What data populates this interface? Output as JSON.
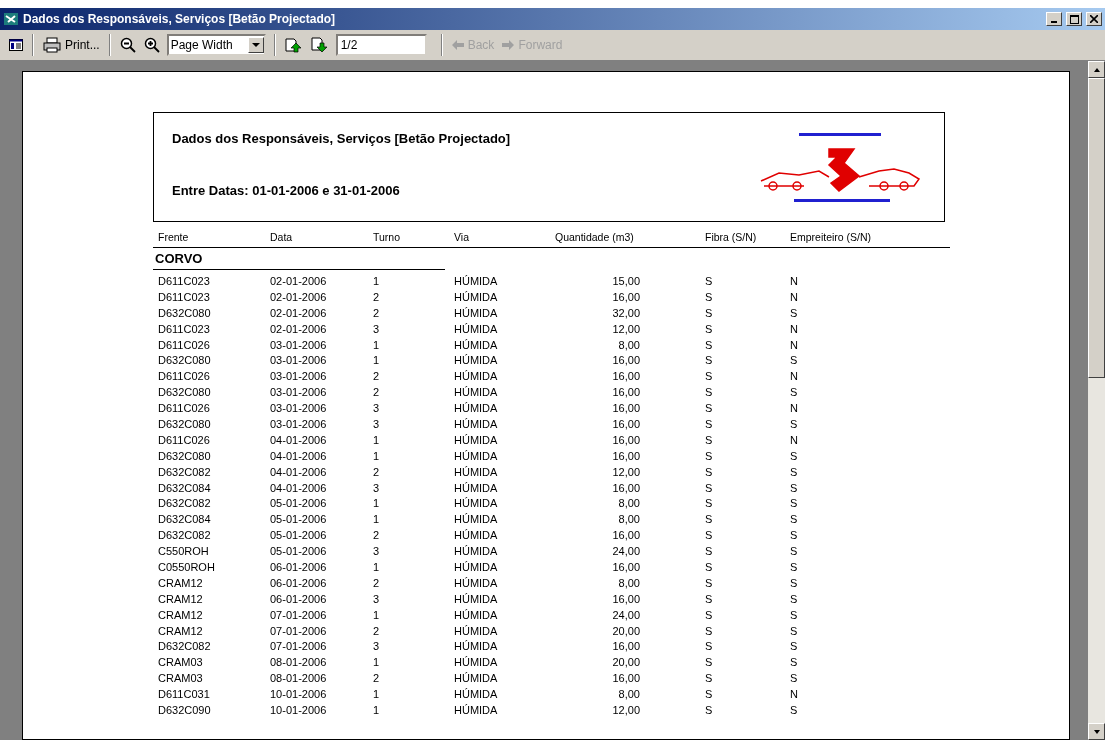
{
  "window": {
    "title": "Dados dos Responsáveis, Serviços [Betão Projectado]"
  },
  "toolbar": {
    "print": "Print...",
    "zoom": "Page Width",
    "page": "1/2",
    "back": {
      "label": "Back",
      "disabled": true
    },
    "forward": {
      "label": "Forward",
      "disabled": true
    }
  },
  "report": {
    "title": "Dados dos Responsáveis, Serviços [Betão Projectado]",
    "subtitle": "Entre Datas: 01-01-2006 e 31-01-2006",
    "columns": [
      "Frente",
      "Data",
      "Turno",
      "Via",
      "Quantidade (m3)",
      "Fibra (S/N)",
      "Empreiteiro (S/N)"
    ],
    "groups": [
      {
        "name": "CORVO",
        "rows": [
          [
            "D611C023",
            "02-01-2006",
            "1",
            "HÚMIDA",
            "15,00",
            "S",
            "N"
          ],
          [
            "D611C023",
            "02-01-2006",
            "2",
            "HÚMIDA",
            "16,00",
            "S",
            "N"
          ],
          [
            "D632C080",
            "02-01-2006",
            "2",
            "HÚMIDA",
            "32,00",
            "S",
            "S"
          ],
          [
            "D611C023",
            "02-01-2006",
            "3",
            "HÚMIDA",
            "12,00",
            "S",
            "N"
          ],
          [
            "D611C026",
            "03-01-2006",
            "1",
            "HÚMIDA",
            "8,00",
            "S",
            "N"
          ],
          [
            "D632C080",
            "03-01-2006",
            "1",
            "HÚMIDA",
            "16,00",
            "S",
            "S"
          ],
          [
            "D611C026",
            "03-01-2006",
            "2",
            "HÚMIDA",
            "16,00",
            "S",
            "N"
          ],
          [
            "D632C080",
            "03-01-2006",
            "2",
            "HÚMIDA",
            "16,00",
            "S",
            "S"
          ],
          [
            "D611C026",
            "03-01-2006",
            "3",
            "HÚMIDA",
            "16,00",
            "S",
            "N"
          ],
          [
            "D632C080",
            "03-01-2006",
            "3",
            "HÚMIDA",
            "16,00",
            "S",
            "S"
          ],
          [
            "D611C026",
            "04-01-2006",
            "1",
            "HÚMIDA",
            "16,00",
            "S",
            "N"
          ],
          [
            "D632C080",
            "04-01-2006",
            "1",
            "HÚMIDA",
            "16,00",
            "S",
            "S"
          ],
          [
            "D632C082",
            "04-01-2006",
            "2",
            "HÚMIDA",
            "12,00",
            "S",
            "S"
          ],
          [
            "D632C084",
            "04-01-2006",
            "3",
            "HÚMIDA",
            "16,00",
            "S",
            "S"
          ],
          [
            "D632C082",
            "05-01-2006",
            "1",
            "HÚMIDA",
            "8,00",
            "S",
            "S"
          ],
          [
            "D632C084",
            "05-01-2006",
            "1",
            "HÚMIDA",
            "8,00",
            "S",
            "S"
          ],
          [
            "D632C082",
            "05-01-2006",
            "2",
            "HÚMIDA",
            "16,00",
            "S",
            "S"
          ],
          [
            "C550ROH",
            "05-01-2006",
            "3",
            "HÚMIDA",
            "24,00",
            "S",
            "S"
          ],
          [
            "C0550ROH",
            "06-01-2006",
            "1",
            "HÚMIDA",
            "16,00",
            "S",
            "S"
          ],
          [
            "CRAM12",
            "06-01-2006",
            "2",
            "HÚMIDA",
            "8,00",
            "S",
            "S"
          ],
          [
            "CRAM12",
            "06-01-2006",
            "3",
            "HÚMIDA",
            "16,00",
            "S",
            "S"
          ],
          [
            "CRAM12",
            "07-01-2006",
            "1",
            "HÚMIDA",
            "24,00",
            "S",
            "S"
          ],
          [
            "CRAM12",
            "07-01-2006",
            "2",
            "HÚMIDA",
            "20,00",
            "S",
            "S"
          ],
          [
            "D632C082",
            "07-01-2006",
            "3",
            "HÚMIDA",
            "16,00",
            "S",
            "S"
          ],
          [
            "CRAM03",
            "08-01-2006",
            "1",
            "HÚMIDA",
            "20,00",
            "S",
            "S"
          ],
          [
            "CRAM03",
            "08-01-2006",
            "2",
            "HÚMIDA",
            "16,00",
            "S",
            "S"
          ],
          [
            "D611C031",
            "10-01-2006",
            "1",
            "HÚMIDA",
            "8,00",
            "S",
            "N"
          ],
          [
            "D632C090",
            "10-01-2006",
            "1",
            "HÚMIDA",
            "12,00",
            "S",
            "S"
          ]
        ]
      }
    ]
  }
}
